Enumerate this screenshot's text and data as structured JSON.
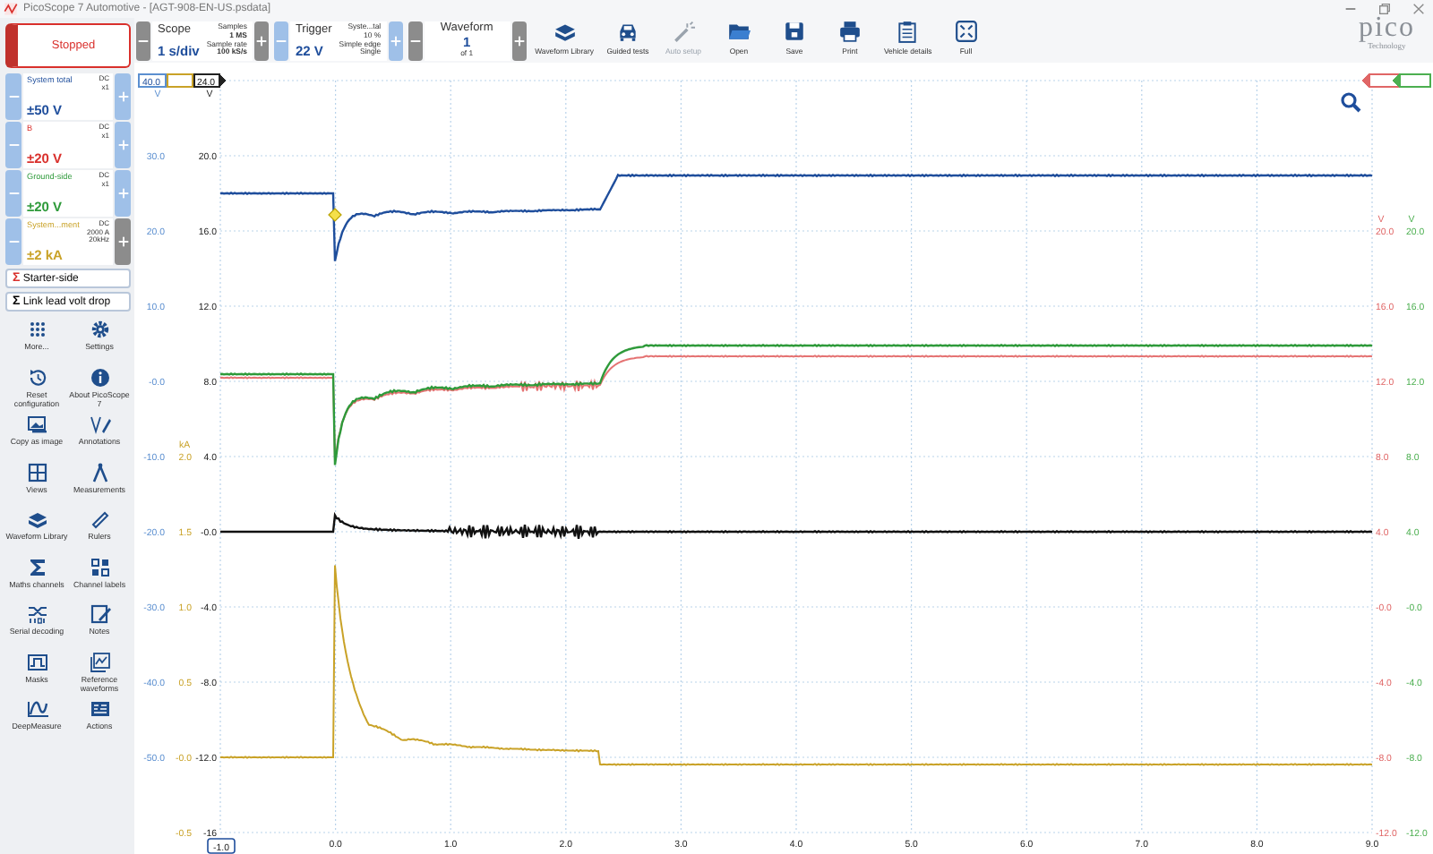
{
  "window": {
    "title": "PicoScope 7 Automotive - [AGT-908-EN-US.psdata]"
  },
  "run_button": {
    "label": "Stopped",
    "running": false
  },
  "channels": [
    {
      "name": "System total",
      "coupling": "DC",
      "probe": [
        "x1"
      ],
      "range": "±50 V",
      "color": "#1f4e9c",
      "plus_enabled": true
    },
    {
      "name": "B",
      "coupling": "DC",
      "probe": [
        "x1"
      ],
      "range": "±20 V",
      "color": "#d9302c",
      "plus_enabled": true
    },
    {
      "name": "Ground-side",
      "coupling": "DC",
      "probe": [
        "x1"
      ],
      "range": "±20 V",
      "color": "#2e9a3a",
      "plus_enabled": true
    },
    {
      "name": "System...ment",
      "coupling": "DC",
      "probe": [
        "2000 A",
        "20kHz"
      ],
      "range": "±2 kA",
      "color": "#c9a227",
      "plus_enabled": false
    }
  ],
  "math_channels": [
    {
      "symbol": "Σ",
      "label": "Starter-side",
      "color": "#d9302c"
    },
    {
      "symbol": "Σ",
      "label": "Link lead volt drop",
      "color": "#000000"
    }
  ],
  "tools": [
    {
      "kind": "dots",
      "label": "More..."
    },
    {
      "kind": "gear",
      "label": "Settings"
    },
    {
      "kind": "reset",
      "label": "Reset configuration"
    },
    {
      "kind": "info",
      "label": "About PicoScope 7"
    },
    {
      "kind": "image",
      "label": "Copy as image"
    },
    {
      "kind": "pen",
      "label": "Annotations"
    },
    {
      "kind": "grid",
      "label": "Views"
    },
    {
      "kind": "compass",
      "label": "Measurements"
    },
    {
      "kind": "stack",
      "label": "Waveform Library"
    },
    {
      "kind": "ruler",
      "label": "Rulers"
    },
    {
      "kind": "sigma",
      "label": "Maths channels"
    },
    {
      "kind": "letters",
      "label": "Channel labels"
    },
    {
      "kind": "serial",
      "label": "Serial decoding"
    },
    {
      "kind": "note",
      "label": "Notes"
    },
    {
      "kind": "mask",
      "label": "Masks"
    },
    {
      "kind": "refwave",
      "label": "Reference waveforms"
    },
    {
      "kind": "deep",
      "label": "DeepMeasure"
    },
    {
      "kind": "actions",
      "label": "Actions"
    }
  ],
  "toolbar": {
    "controls": [
      {
        "kind": "plain",
        "title": "Scope",
        "value": "1 s/div",
        "info": [
          "Samples",
          "1 MS",
          "Sample rate",
          "100 kS/s"
        ]
      },
      {
        "kind": "accent",
        "title": "Trigger",
        "value": "22 V",
        "info": [
          "Syste...tal",
          "10 %",
          "Simple edge",
          "Single"
        ]
      },
      {
        "kind": "centered",
        "title": "Waveform",
        "value": "1",
        "info": [
          "of 1"
        ]
      }
    ],
    "buttons": [
      {
        "kind": "stack",
        "label": "Waveform Library",
        "disabled": false
      },
      {
        "kind": "car",
        "label": "Guided tests",
        "disabled": false
      },
      {
        "kind": "wand",
        "label": "Auto setup",
        "disabled": true
      },
      {
        "kind": "folder",
        "label": "Open",
        "disabled": false
      },
      {
        "kind": "save",
        "label": "Save",
        "disabled": false
      },
      {
        "kind": "print",
        "label": "Print",
        "disabled": false
      },
      {
        "kind": "clipboard",
        "label": "Vehicle details",
        "disabled": false
      },
      {
        "kind": "full",
        "label": "Full",
        "disabled": false
      }
    ]
  },
  "logo": {
    "text": "pico",
    "tagline": "Technology"
  },
  "chart": {
    "left_axes": [
      {
        "unit": "V",
        "color": "#5b8fd0",
        "marker": true,
        "marker_text": "40.0",
        "kind": "top",
        "labels": [
          "30.0",
          "20.0",
          "10.0",
          "-0.0",
          "-10.0",
          "-20.0",
          "-30.0",
          "-40.0",
          "-50.0"
        ]
      },
      {
        "unit": "kA",
        "color": "#c9a227",
        "marker": true,
        "kind": "bottom",
        "labels": [
          "2.0",
          "1.5",
          "1.0",
          "0.5",
          "-0.0",
          "-0.5"
        ]
      },
      {
        "unit": "V",
        "color": "#222222",
        "marker": true,
        "marker_text": "24.0",
        "kind": "top",
        "labels": [
          "20.0",
          "16.0",
          "12.0",
          "8.0",
          "4.0",
          "-0.0",
          "-4.0",
          "-8.0",
          "-12.0",
          "-16"
        ]
      }
    ],
    "right_axes": [
      {
        "unit": "V",
        "color": "#e06666",
        "marker": true,
        "kind": "bottom",
        "labels": [
          "20.0",
          "16.0",
          "12.0",
          "8.0",
          "4.0",
          "-0.0",
          "-4.0",
          "-8.0",
          "-12.0"
        ]
      },
      {
        "unit": "V",
        "color": "#4caf50",
        "marker": true,
        "kind": "bottom",
        "labels": [
          "20.0",
          "16.0",
          "12.0",
          "8.0",
          "4.0",
          "-0.0",
          "-4.0",
          "-8.0",
          "-12.0"
        ]
      }
    ],
    "time_labels": [
      "-1.0",
      "0.0",
      "1.0",
      "2.0",
      "3.0",
      "4.0",
      "5.0",
      "6.0",
      "7.0",
      "8.0",
      "9.0"
    ]
  }
}
